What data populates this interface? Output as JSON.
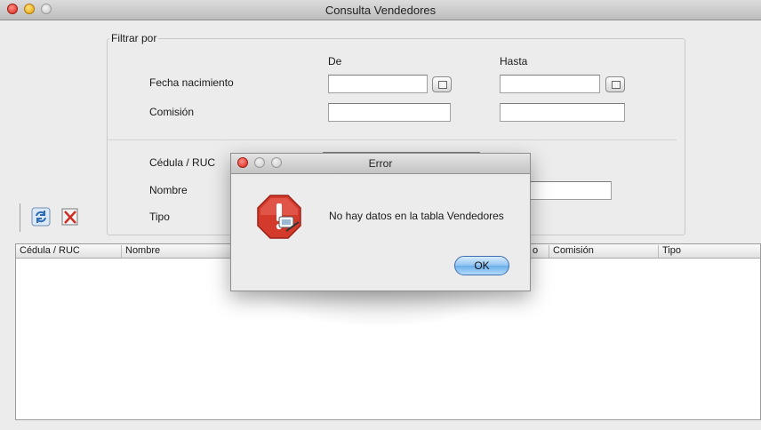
{
  "window": {
    "title": "Consulta Vendedores"
  },
  "filter": {
    "legend": "Filtrar por",
    "col_from": "De",
    "col_to": "Hasta",
    "labels": {
      "birth_date": "Fecha nacimiento",
      "commission": "Comisión",
      "id": "Cédula / RUC",
      "name": "Nombre",
      "type": "Tipo"
    }
  },
  "toolbar": {
    "refresh_icon": "refresh-icon",
    "clear_icon": "clear-icon"
  },
  "table": {
    "columns": [
      "Cédula / RUC",
      "Nombre",
      "o",
      "Comisión",
      "Tipo"
    ],
    "rows": []
  },
  "dialog": {
    "title": "Error",
    "message": "No hay datos en la tabla Vendedores",
    "ok_label": "OK",
    "icon": "stop-icon"
  },
  "colors": {
    "accent": "#6aaeea",
    "stop_red": "#d43a2c"
  }
}
